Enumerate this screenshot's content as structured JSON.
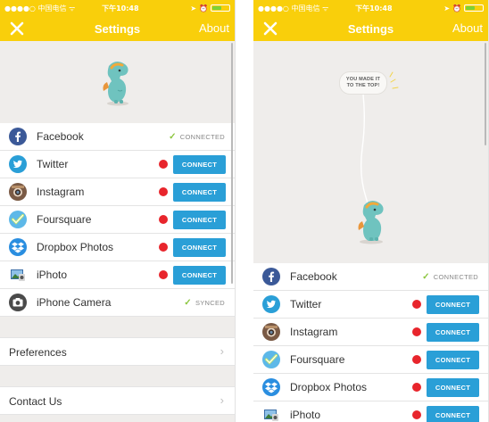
{
  "statusbar": {
    "carrier": "●●●●○ 中国电信 ᯤ",
    "signal_note": "27%",
    "time": "下午10:48",
    "battery_level": 0.55,
    "battery_color": "#7bd13a"
  },
  "navbar": {
    "title": "Settings",
    "about": "About",
    "bg_color": "#f9cf0b"
  },
  "hero": {
    "speech_line1": "YOU MADE IT",
    "speech_line2": "TO THE TOP!"
  },
  "services": [
    {
      "name": "Facebook",
      "status": "connected",
      "status_text": "CONNECTED",
      "icon": "facebook-icon"
    },
    {
      "name": "Twitter",
      "status": "disconnected",
      "button": "CONNECT",
      "icon": "twitter-icon"
    },
    {
      "name": "Instagram",
      "status": "disconnected",
      "button": "CONNECT",
      "icon": "instagram-icon"
    },
    {
      "name": "Foursquare",
      "status": "disconnected",
      "button": "CONNECT",
      "icon": "foursquare-icon"
    },
    {
      "name": "Dropbox Photos",
      "status": "disconnected",
      "button": "CONNECT",
      "icon": "dropbox-icon"
    },
    {
      "name": "iPhoto",
      "status": "disconnected",
      "button": "CONNECT",
      "icon": "iphoto-icon"
    },
    {
      "name": "iPhone Camera",
      "status": "synced",
      "status_text": "SYNCED",
      "icon": "camera-icon"
    }
  ],
  "menu": {
    "preferences": "Preferences",
    "contact": "Contact Us",
    "chevron": "›"
  },
  "colors": {
    "connect_blue": "#2a9fd7",
    "status_red": "#e8252c",
    "check_green": "#8cc63f"
  }
}
